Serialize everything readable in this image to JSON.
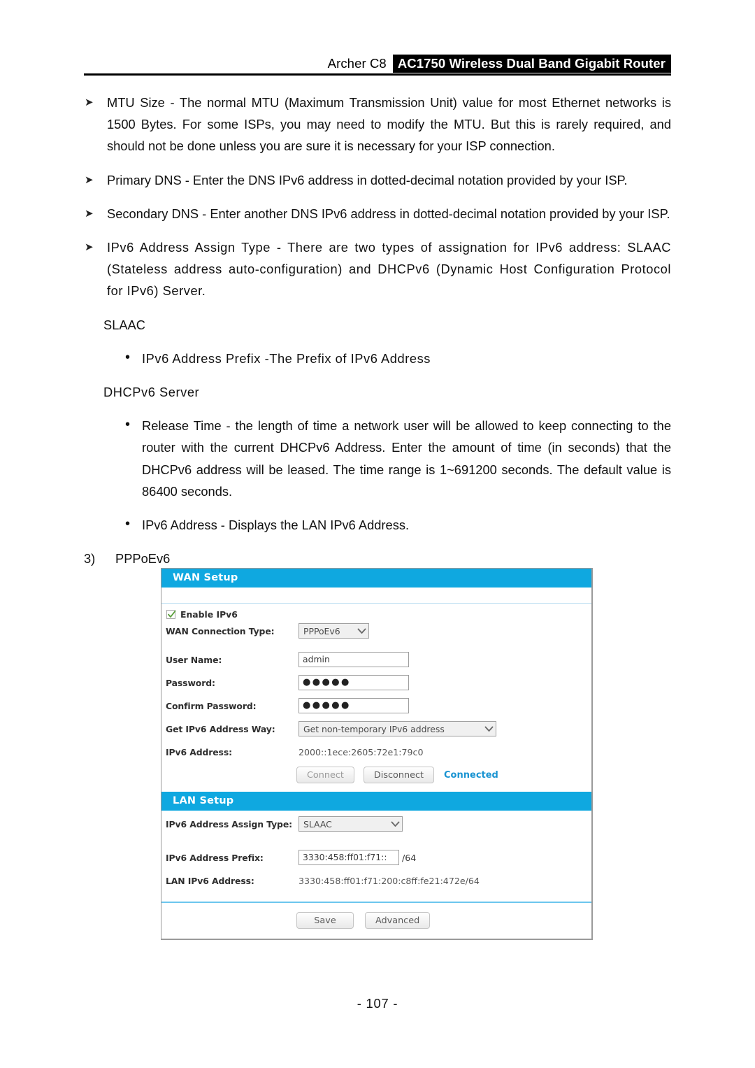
{
  "header": {
    "model": "Archer C8",
    "product": "AC1750 Wireless Dual Band Gigabit Router"
  },
  "body_text": {
    "mtu_size": "MTU Size - The normal MTU (Maximum Transmission Unit) value for most Ethernet networks is 1500 Bytes. For some ISPs, you may need to modify the MTU. But this is rarely required, and should not be done unless you are sure it is necessary for your ISP connection.",
    "primary_dns": "Primary DNS - Enter the DNS IPv6 address in dotted-decimal notation provided by your ISP.",
    "secondary_dns": "Secondary DNS - Enter another DNS IPv6 address in dotted-decimal notation provided by your ISP.",
    "assign_type": "IPv6 Address Assign Type - There are two types of assignation for IPv6 address: SLAAC (Stateless address auto-configuration) and DHCPv6 (Dynamic Host Configuration Protocol for IPv6) Server.",
    "slaac_heading": "SLAAC",
    "slaac_bullet": "IPv6 Address Prefix -The Prefix of IPv6 Address",
    "dhcpv6_heading": "DHCPv6 Server",
    "release_time_bullet": "Release Time - the length of time a network user will be allowed to keep connecting to the router with the current DHCPv6 Address. Enter the amount of time (in seconds) that the DHCPv6 address will be leased. The time range is 1~691200 seconds. The default value is 86400 seconds.",
    "ipv6_address_bullet": "IPv6 Address - Displays the LAN IPv6 Address.",
    "section_number": "3)",
    "section_title": "PPPoEv6",
    "arrow_marker": "➤",
    "bullet_marker": "•"
  },
  "router_ui": {
    "wan_setup": {
      "title": "WAN Setup",
      "enable_ipv6_label": "Enable IPv6",
      "enable_ipv6_checked": true,
      "wan_connection_type_label": "WAN Connection Type:",
      "wan_connection_type_value": "PPPoEv6",
      "user_name_label": "User Name:",
      "user_name_value": "admin",
      "password_label": "Password:",
      "password_value": "●●●●●",
      "confirm_password_label": "Confirm Password:",
      "confirm_password_value": "●●●●●",
      "get_ipv6_way_label": "Get IPv6 Address Way:",
      "get_ipv6_way_value": "Get non-temporary IPv6 address",
      "ipv6_address_label": "IPv6 Address:",
      "ipv6_address_value": "2000::1ece:2605:72e1:79c0",
      "connect_button": "Connect",
      "disconnect_button": "Disconnect",
      "status": "Connected"
    },
    "lan_setup": {
      "title": "LAN Setup",
      "assign_type_label": "IPv6 Address Assign Type:",
      "assign_type_value": "SLAAC",
      "prefix_label": "IPv6 Address Prefix:",
      "prefix_value": "3330:458:ff01:f71::",
      "prefix_suffix": "/64",
      "lan_ipv6_label": "LAN IPv6 Address:",
      "lan_ipv6_value": "3330:458:ff01:f71:200:c8ff:fe21:472e/64"
    },
    "footer": {
      "save_button": "Save",
      "advanced_button": "Advanced"
    },
    "colors": {
      "section_bar": "#0fa8e0",
      "status_text": "#1a94d2",
      "check_mark": "#5a9e3a"
    }
  },
  "page_footer": {
    "page_number": "- 107 -"
  }
}
